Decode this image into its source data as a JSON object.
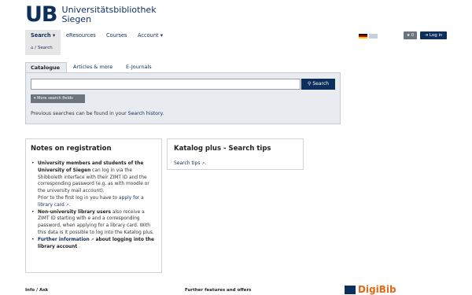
{
  "logo": {
    "mark": "UB",
    "line1": "Universitätsbibliothek",
    "line2": "Siegen"
  },
  "nav": {
    "search": "Search ▾",
    "eresources": "eResources",
    "courses": "Courses",
    "account": "Account ▾"
  },
  "header": {
    "favorites_label": "★ 0",
    "login_label": "⇥ Log in"
  },
  "breadcrumb": {
    "home_icon": "⌂",
    "label": "/ Search"
  },
  "tabs": {
    "catalogue": "Catalogue",
    "articles": "Articles & more",
    "ejournals": "E-Journals"
  },
  "search": {
    "value": "",
    "placeholder": "",
    "button_label": "⚲ Search",
    "more_fields": "▾ More search fields",
    "history_prefix": "Previous searches can be found in your ",
    "history_link": "Search history",
    "history_suffix": "."
  },
  "notes": {
    "title": "Notes on registration",
    "item1_bold": "University members and students of the University of Siegen",
    "item1_text": " can log in via the Shibboleth interface with their ZIMT ID and the corresponding password (e.g. as with moodle or the university mail account).",
    "item2_text": "Prior to the first log in you have to ",
    "item2_link": "apply for a library card",
    "item3_bold": "Non-university library users",
    "item3_text": " also receive a ZIMT ID starting with e and a corresponding password, when applying for a library card. With this data is it possible to log into the Katalog plus.",
    "item4_link": "Further information",
    "item4_bold": " about logging into the library account"
  },
  "tips": {
    "title": "Katalog plus - Search tips",
    "link": "Search tips"
  },
  "footer": {
    "info": "Info / Ask",
    "more": "Further features and offers",
    "digibib": "DigiBib"
  },
  "colors": {
    "brand": "#0c2f5c",
    "panel": "#e8ebef",
    "button_secondary": "#6c757d",
    "digibib_orange": "#e06a1a"
  }
}
